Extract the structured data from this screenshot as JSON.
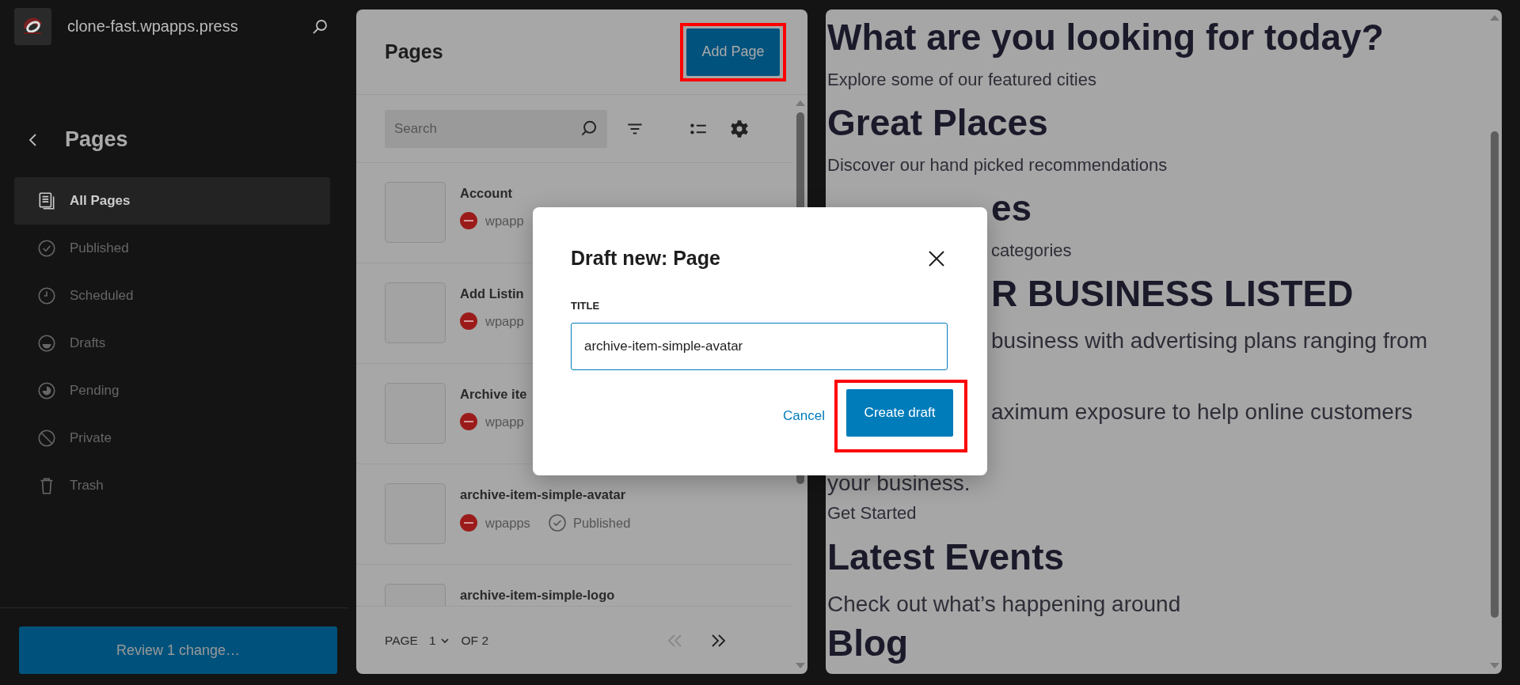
{
  "sidebar": {
    "site_name": "clone-fast.wpapps.press",
    "section_title": "Pages",
    "items": [
      {
        "label": "All Pages",
        "selected": true
      },
      {
        "label": "Published",
        "selected": false
      },
      {
        "label": "Scheduled",
        "selected": false
      },
      {
        "label": "Drafts",
        "selected": false
      },
      {
        "label": "Pending",
        "selected": false
      },
      {
        "label": "Private",
        "selected": false
      },
      {
        "label": "Trash",
        "selected": false
      }
    ],
    "review_button": "Review 1 change…"
  },
  "pages_panel": {
    "title": "Pages",
    "add_button": "Add Page",
    "search": {
      "placeholder": "Search"
    },
    "rows": [
      {
        "title": "Account",
        "author": "wpapp"
      },
      {
        "title": "Add Listin",
        "author": "wpapp"
      },
      {
        "title": "Archive ite",
        "author": "wpapp"
      },
      {
        "title": "archive-item-simple-avatar",
        "author": "wpapps",
        "status": "Published"
      },
      {
        "title": "archive-item-simple-logo"
      }
    ],
    "pagination": {
      "label": "PAGE",
      "current": "1",
      "total": "OF 2"
    }
  },
  "preview": {
    "blocks": [
      {
        "kind": "heading",
        "text": "What are you looking for today?"
      },
      {
        "kind": "subtext",
        "text": "Explore some of our featured cities"
      },
      {
        "kind": "heading",
        "text": "Great Places"
      },
      {
        "kind": "subtext",
        "text": "Discover our hand picked recommendations"
      },
      {
        "kind": "heading-tail",
        "text": "es"
      },
      {
        "kind": "subtext-tail",
        "text": "categories"
      },
      {
        "kind": "heading-tail",
        "text": "R BUSINESS LISTED"
      },
      {
        "kind": "lead-tail",
        "text": "business with advertising plans ranging from"
      },
      {
        "kind": "lead-tail",
        "text": "aximum exposure to help online customers"
      },
      {
        "kind": "lead",
        "text": "your business."
      },
      {
        "kind": "subtext",
        "text": "Get Started"
      },
      {
        "kind": "heading",
        "text": "Latest Events"
      },
      {
        "kind": "lead",
        "text": "Check out what’s happening around"
      },
      {
        "kind": "heading",
        "text": "Blog"
      }
    ]
  },
  "dialog": {
    "title": "Draft new: Page",
    "field_label": "TITLE",
    "field_value": "archive-item-simple-avatar",
    "cancel_button": "Cancel",
    "create_button": "Create draft"
  }
}
